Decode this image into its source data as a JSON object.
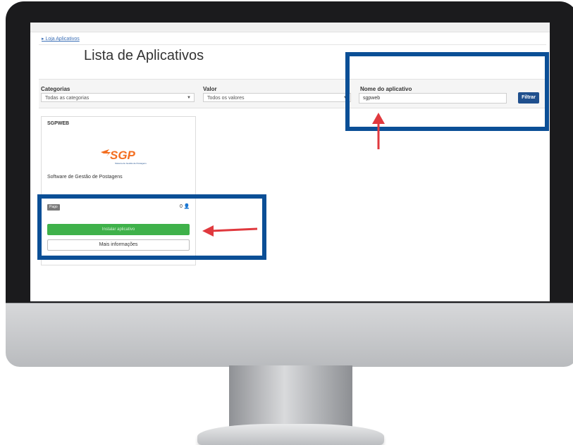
{
  "breadcrumb": {
    "link": "Loja Aplicativos",
    "marker": "▸"
  },
  "page": {
    "title": "Lista de Aplicativos"
  },
  "filters": {
    "categories_label": "Categorias",
    "categories_value": "Todas as categorias",
    "value_label": "Valor",
    "value_value": "Todos os valores",
    "name_label": "Nome do aplicativo",
    "name_value": "sgpweb",
    "filter_button": "Filtrar"
  },
  "app_card": {
    "name": "SGPWEB",
    "logo_text": "SGP",
    "logo_subtitle": "Sistema de Gestão de Postagens",
    "description": "Software de Gestão de Postagens",
    "price_badge": "Pago",
    "user_count": "0",
    "install_button": "Instalar aplicativo",
    "info_button": "Mais informações"
  },
  "colors": {
    "highlight_box": "#0b4f96",
    "arrow": "#e0393e",
    "install_green": "#3fb14a",
    "filter_blue": "#1f4f8d",
    "logo_orange": "#f36f21"
  }
}
